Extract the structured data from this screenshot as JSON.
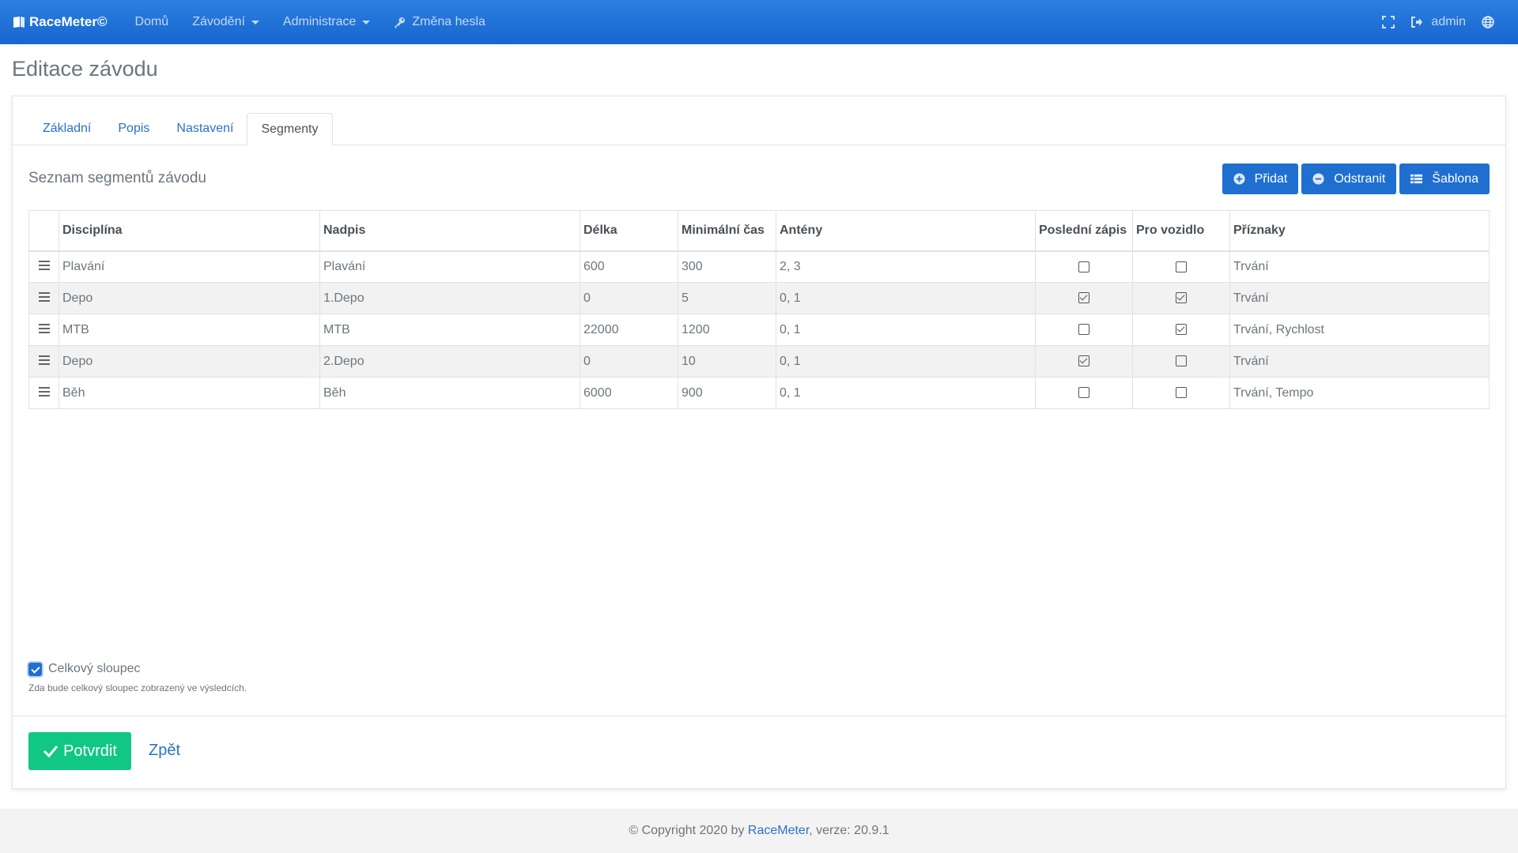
{
  "navbar": {
    "brand": "RaceMeter©",
    "items": [
      {
        "label": "Domů",
        "dropdown": false
      },
      {
        "label": "Závodění",
        "dropdown": true
      },
      {
        "label": "Administrace",
        "dropdown": true
      },
      {
        "label": "Změna hesla",
        "icon": "key-icon"
      }
    ],
    "user": "admin",
    "right_icons": [
      "fullscreen-icon",
      "logout-icon",
      "globe-icon"
    ]
  },
  "page_title": "Editace závodu",
  "tabs": [
    {
      "label": "Základní",
      "active": false
    },
    {
      "label": "Popis",
      "active": false
    },
    {
      "label": "Nastavení",
      "active": false
    },
    {
      "label": "Segmenty",
      "active": true
    }
  ],
  "section_title": "Seznam segmentů závodu",
  "buttons": {
    "add": "Přidat",
    "remove": "Odstranit",
    "template": "Šablona"
  },
  "table": {
    "headers": [
      "",
      "Disciplína",
      "Nadpis",
      "Délka",
      "Minimální čas",
      "Antény",
      "Poslední zápis",
      "Pro vozidlo",
      "Příznaky"
    ],
    "rows": [
      {
        "discipline": "Plavání",
        "title": "Plavání",
        "length": "600",
        "min_time": "300",
        "antennas": "2, 3",
        "last_record": false,
        "vehicle": false,
        "flags": "Trvání"
      },
      {
        "discipline": "Depo",
        "title": "1.Depo",
        "length": "0",
        "min_time": "5",
        "antennas": "0, 1",
        "last_record": true,
        "vehicle": true,
        "flags": "Trvání"
      },
      {
        "discipline": "MTB",
        "title": "MTB",
        "length": "22000",
        "min_time": "1200",
        "antennas": "0, 1",
        "last_record": false,
        "vehicle": true,
        "flags": "Trvání, Rychlost"
      },
      {
        "discipline": "Depo",
        "title": "2.Depo",
        "length": "0",
        "min_time": "10",
        "antennas": "0, 1",
        "last_record": true,
        "vehicle": false,
        "flags": "Trvání"
      },
      {
        "discipline": "Běh",
        "title": "Běh",
        "length": "6000",
        "min_time": "900",
        "antennas": "0, 1",
        "last_record": false,
        "vehicle": false,
        "flags": "Trvání, Tempo"
      }
    ]
  },
  "total_column": {
    "label": "Celkový sloupec",
    "checked": true,
    "help": "Zda bude celkový sloupec zobrazený ve výsledcích."
  },
  "footer_actions": {
    "confirm": "Potvrdit",
    "back": "Zpět"
  },
  "footer": {
    "prefix": "© Copyright 2020 by ",
    "link": "RaceMeter",
    "suffix": ", verze: 20.9.1"
  },
  "colors": {
    "navbar": "#1766cf",
    "primary": "#1f6fd1",
    "success": "#10c784",
    "link": "#2b71c9"
  }
}
